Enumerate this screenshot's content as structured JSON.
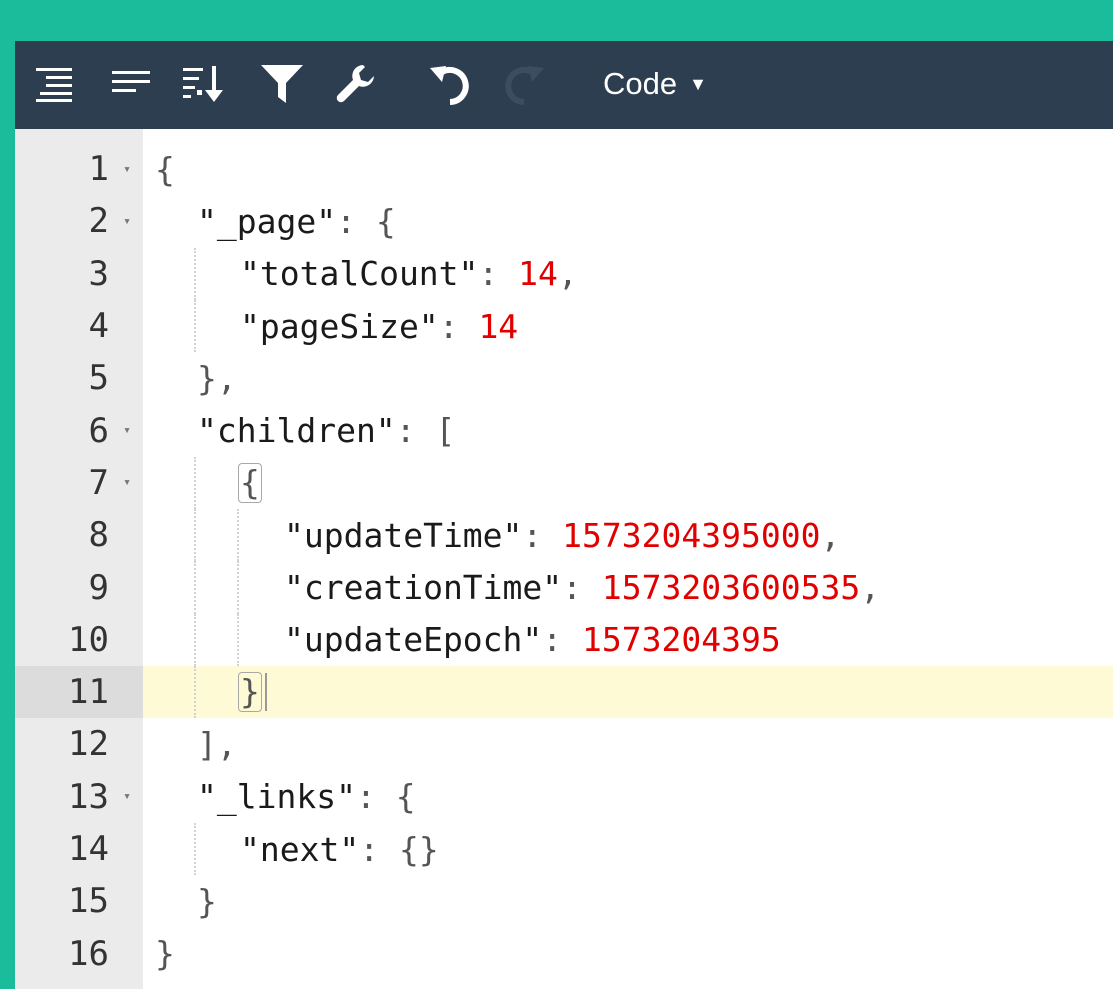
{
  "toolbar": {
    "buttons": [
      {
        "name": "format-icon"
      },
      {
        "name": "compact-icon"
      },
      {
        "name": "sort-icon"
      },
      {
        "name": "filter-icon"
      },
      {
        "name": "repair-icon"
      },
      {
        "name": "undo-icon"
      },
      {
        "name": "redo-icon"
      }
    ],
    "mode_label": "Code",
    "mode_caret": "▼"
  },
  "editor": {
    "active_line": 11,
    "lines": [
      {
        "n": "1",
        "fold": "▾"
      },
      {
        "n": "2",
        "fold": "▾"
      },
      {
        "n": "3",
        "fold": ""
      },
      {
        "n": "4",
        "fold": ""
      },
      {
        "n": "5",
        "fold": ""
      },
      {
        "n": "6",
        "fold": "▾"
      },
      {
        "n": "7",
        "fold": "▾"
      },
      {
        "n": "8",
        "fold": ""
      },
      {
        "n": "9",
        "fold": ""
      },
      {
        "n": "10",
        "fold": ""
      },
      {
        "n": "11",
        "fold": ""
      },
      {
        "n": "12",
        "fold": ""
      },
      {
        "n": "13",
        "fold": "▾"
      },
      {
        "n": "14",
        "fold": ""
      },
      {
        "n": "15",
        "fold": ""
      },
      {
        "n": "16",
        "fold": ""
      }
    ],
    "tokens": {
      "open_brace": "{",
      "close_brace": "}",
      "open_bracket": "[",
      "close_bracket": "]",
      "colon": ": ",
      "comma": ",",
      "page_key": "\"_page\"",
      "totalCount_key": "\"totalCount\"",
      "totalCount_val": "14",
      "pageSize_key": "\"pageSize\"",
      "pageSize_val": "14",
      "children_key": "\"children\"",
      "updateTime_key": "\"updateTime\"",
      "updateTime_val": "1573204395000",
      "creationTime_key": "\"creationTime\"",
      "creationTime_val": "1573203600535",
      "updateEpoch_key": "\"updateEpoch\"",
      "updateEpoch_val": "1573204395",
      "links_key": "\"_links\"",
      "next_key": "\"next\"",
      "empty_obj": "{}"
    }
  }
}
